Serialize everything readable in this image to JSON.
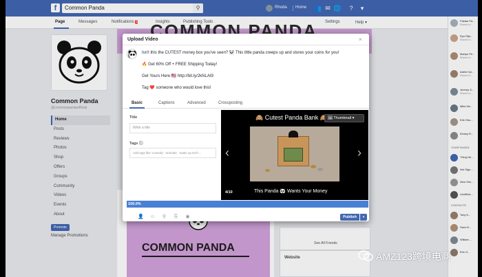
{
  "topbar": {
    "logo": "f",
    "search_value": "Common Panda",
    "user_name": "Rhoda",
    "home_label": "Home",
    "accent": "#4267b2"
  },
  "page_tabs": [
    {
      "label": "Page",
      "active": true
    },
    {
      "label": "Messages",
      "active": false
    },
    {
      "label": "Notifications",
      "badge": "1",
      "active": false
    },
    {
      "label": "Insights",
      "active": false
    },
    {
      "label": "Publishing Tools",
      "active": false
    },
    {
      "label": "Settings",
      "active": false
    },
    {
      "label": "Help",
      "active": false
    }
  ],
  "left": {
    "page_name": "Common Panda",
    "handle": "@commonpandaofficial",
    "nav": [
      "Home",
      "Posts",
      "Reviews",
      "Photos",
      "Shop",
      "Offers",
      "Groups",
      "Community",
      "Videos",
      "Events",
      "About"
    ],
    "promote_label": "Promote",
    "manage_promotions": "Manage Promotions"
  },
  "cover": {
    "text": "COMMON PANDA"
  },
  "post": {
    "brand": "COMMON PANDA"
  },
  "right": {
    "see_all_friends": "See All Friends",
    "websites_label": "Website"
  },
  "chat": {
    "people": [
      {
        "name": "Fabian Pa...",
        "sub": "Shared a l..."
      },
      {
        "name": "Ryo Rijir...",
        "sub": "Shared a l..."
      },
      {
        "name": "Martyn Pe...",
        "sub": "Shared a l..."
      },
      {
        "name": "Adele Kol...",
        "sub": "Shared a l..."
      },
      {
        "name": "Jeremy S...",
        "sub": "Shared a l..."
      },
      {
        "name": "Mike Mo...",
        "sub": ""
      },
      {
        "name": "Erik Stru...",
        "sub": ""
      },
      {
        "name": "Kinsey R...",
        "sub": ""
      }
    ],
    "section_pages": "YOUR PAGES",
    "pages": [
      {
        "name": "Thing Ne..."
      },
      {
        "name": "Not Sign..."
      },
      {
        "name": "New Sho..."
      },
      {
        "name": "Unofficia..."
      }
    ],
    "section_contacts": "CONTACTS",
    "contacts": [
      {
        "name": "Toby K..."
      },
      {
        "name": "Sara Ki..."
      },
      {
        "name": "William ..."
      },
      {
        "name": "Eric G..."
      }
    ]
  },
  "modal": {
    "title": "Upload Video",
    "close": "×",
    "post_lines": [
      "Isn't this the CUTEST money box you've seen? 🐼 This little panda creeps up and stores your coins for you!",
      "🔥 Get 60% Off + FREE Shipping Today!",
      "Get Yours Here 🇺🇸 http://bit.ly/2kNLAI9",
      "Tag ❤️ someone who would love this!"
    ],
    "tabs": [
      {
        "label": "Basic",
        "active": true
      },
      {
        "label": "Captions",
        "active": false
      },
      {
        "label": "Advanced",
        "active": false
      },
      {
        "label": "Crossposting",
        "active": false
      }
    ],
    "title_label": "Title",
    "title_placeholder": "Write a title",
    "tags_label": "Tags",
    "tags_info": "ⓘ",
    "tags_placeholder": "Add tags like 'comedy', 'animals', 'make up tech'...",
    "thumbnail": {
      "title": "🙈 Cutest Panda Bank 🙈",
      "button": "🖼 Thumbnail ▾",
      "caption": "This Panda 🐼 Wants Your Money",
      "count": "4/10"
    },
    "progress": {
      "label": "100.0%",
      "value_percent": 100
    },
    "publish_label": "Publish",
    "publish_caret": "▾"
  },
  "watermark": {
    "text": "AMZ123跨境电商"
  }
}
